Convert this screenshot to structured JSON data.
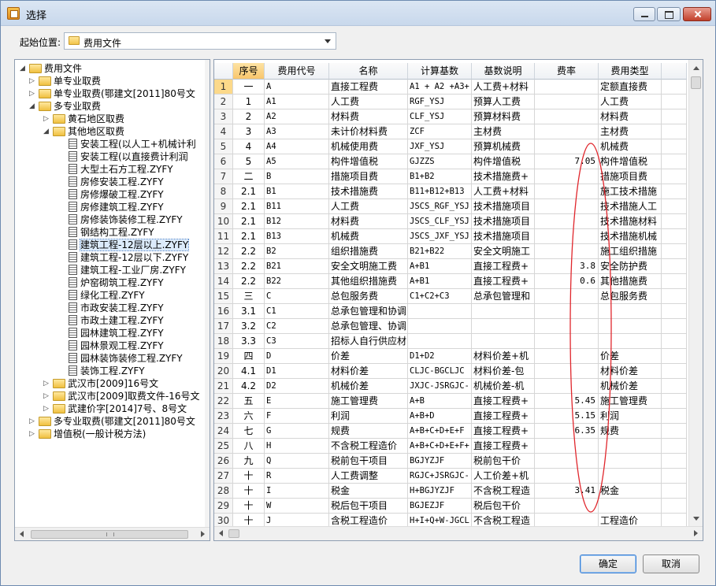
{
  "window": {
    "title": "选择"
  },
  "start": {
    "label": "起始位置:",
    "value": "费用文件"
  },
  "tree": [
    {
      "label": "费用文件",
      "level": 0,
      "type": "folder",
      "expander": "◢"
    },
    {
      "label": "单专业取费",
      "level": 1,
      "type": "folder",
      "expander": "▷"
    },
    {
      "label": "单专业取费(鄂建文[2011]80号文",
      "level": 1,
      "type": "folder",
      "expander": "▷"
    },
    {
      "label": "多专业取费",
      "level": 1,
      "type": "folder",
      "expander": "◢"
    },
    {
      "label": "黄石地区取费",
      "level": 2,
      "type": "folder",
      "expander": "▷"
    },
    {
      "label": "其他地区取费",
      "level": 2,
      "type": "folder",
      "expander": "◢"
    },
    {
      "label": "安装工程(以人工+机械计利",
      "level": 3,
      "type": "doc",
      "expander": ""
    },
    {
      "label": "安装工程(以直接费计利润",
      "level": 3,
      "type": "doc",
      "expander": ""
    },
    {
      "label": "大型土石方工程.ZYFY",
      "level": 3,
      "type": "doc",
      "expander": ""
    },
    {
      "label": "房修安装工程.ZYFY",
      "level": 3,
      "type": "doc",
      "expander": ""
    },
    {
      "label": "房修爆破工程.ZYFY",
      "level": 3,
      "type": "doc",
      "expander": ""
    },
    {
      "label": "房修建筑工程.ZYFY",
      "level": 3,
      "type": "doc",
      "expander": ""
    },
    {
      "label": "房修装饰装修工程.ZYFY",
      "level": 3,
      "type": "doc",
      "expander": ""
    },
    {
      "label": "钢结构工程.ZYFY",
      "level": 3,
      "type": "doc",
      "expander": ""
    },
    {
      "label": "建筑工程-12层以上.ZYFY",
      "level": 3,
      "type": "doc",
      "expander": "",
      "selected": true
    },
    {
      "label": "建筑工程-12层以下.ZYFY",
      "level": 3,
      "type": "doc",
      "expander": ""
    },
    {
      "label": "建筑工程-工业厂房.ZYFY",
      "level": 3,
      "type": "doc",
      "expander": ""
    },
    {
      "label": "炉窑砌筑工程.ZYFY",
      "level": 3,
      "type": "doc",
      "expander": ""
    },
    {
      "label": "绿化工程.ZYFY",
      "level": 3,
      "type": "doc",
      "expander": ""
    },
    {
      "label": "市政安装工程.ZYFY",
      "level": 3,
      "type": "doc",
      "expander": ""
    },
    {
      "label": "市政土建工程.ZYFY",
      "level": 3,
      "type": "doc",
      "expander": ""
    },
    {
      "label": "园林建筑工程.ZYFY",
      "level": 3,
      "type": "doc",
      "expander": ""
    },
    {
      "label": "园林景观工程.ZYFY",
      "level": 3,
      "type": "doc",
      "expander": ""
    },
    {
      "label": "园林装饰装修工程.ZYFY",
      "level": 3,
      "type": "doc",
      "expander": ""
    },
    {
      "label": "装饰工程.ZYFY",
      "level": 3,
      "type": "doc",
      "expander": ""
    },
    {
      "label": "武汉市[2009]16号文",
      "level": 2,
      "type": "folder",
      "expander": "▷"
    },
    {
      "label": "武汉市[2009]取费文件-16号文",
      "level": 2,
      "type": "folder",
      "expander": "▷"
    },
    {
      "label": "武建价字[2014]7号、8号文",
      "level": 2,
      "type": "folder",
      "expander": "▷"
    },
    {
      "label": "多专业取费(鄂建文[2011]80号文",
      "level": 1,
      "type": "folder",
      "expander": "▷"
    },
    {
      "label": "增值税(一般计税方法)",
      "level": 1,
      "type": "folder",
      "expander": "▷"
    }
  ],
  "grid": {
    "columns": [
      "",
      "序号",
      "费用代号",
      "名称",
      "计算基数",
      "基数说明",
      "费率",
      "费用类型"
    ],
    "rows": [
      [
        "1",
        "一",
        "A",
        "直接工程费",
        "A1 + A2 +A3+",
        "人工费+材料",
        "",
        "定额直接费"
      ],
      [
        "2",
        "1",
        "A1",
        "人工费",
        "RGF_YSJ",
        "预算人工费",
        "",
        "人工费"
      ],
      [
        "3",
        "2",
        "A2",
        "材料费",
        "CLF_YSJ",
        "预算材料费",
        "",
        "材料费"
      ],
      [
        "4",
        "3",
        "A3",
        "未计价材料费",
        "ZCF",
        "主材费",
        "",
        "主材费"
      ],
      [
        "5",
        "4",
        "A4",
        "机械使用费",
        "JXF_YSJ",
        "预算机械费",
        "",
        "机械费"
      ],
      [
        "6",
        "5",
        "A5",
        "构件增值税",
        "GJZZS",
        "构件增值税",
        "7.05",
        "构件增值税"
      ],
      [
        "7",
        "二",
        "B",
        "措施项目费",
        "B1+B2",
        "技术措施费+",
        "",
        "措施项目费"
      ],
      [
        "8",
        "2.1",
        "B1",
        "技术措施费",
        "B11+B12+B13",
        "人工费+材料",
        "",
        "施工技术措施"
      ],
      [
        "9",
        "2.1",
        "B11",
        "人工费",
        "JSCS_RGF_YSJ",
        "技术措施项目",
        "",
        "技术措施人工"
      ],
      [
        "10",
        "2.1",
        "B12",
        "材料费",
        "JSCS_CLF_YSJ",
        "技术措施项目",
        "",
        "技术措施材料"
      ],
      [
        "11",
        "2.1",
        "B13",
        "机械费",
        "JSCS_JXF_YSJ",
        "技术措施项目",
        "",
        "技术措施机械"
      ],
      [
        "12",
        "2.2",
        "B2",
        "组织措施费",
        "B21+B22",
        "安全文明施工",
        "",
        "施工组织措施"
      ],
      [
        "13",
        "2.2",
        "B21",
        "安全文明施工费",
        "A+B1",
        "直接工程费+",
        "3.8",
        "安全防护费"
      ],
      [
        "14",
        "2.2",
        "B22",
        "其他组织措施费",
        "A+B1",
        "直接工程费+",
        "0.6",
        "其他措施费"
      ],
      [
        "15",
        "三",
        "C",
        "总包服务费",
        "C1+C2+C3",
        "总承包管理和",
        "",
        "总包服务费"
      ],
      [
        "16",
        "3.1",
        "C1",
        "总承包管理和协调",
        "",
        "",
        "",
        ""
      ],
      [
        "17",
        "3.2",
        "C2",
        "总承包管理、协调",
        "",
        "",
        "",
        ""
      ],
      [
        "18",
        "3.3",
        "C3",
        "招标人自行供应材",
        "",
        "",
        "",
        ""
      ],
      [
        "19",
        "四",
        "D",
        "价差",
        "D1+D2",
        "材料价差+机",
        "",
        "价差"
      ],
      [
        "20",
        "4.1",
        "D1",
        "材料价差",
        "CLJC-BGCLJC",
        "材料价差-包",
        "",
        "材料价差"
      ],
      [
        "21",
        "4.2",
        "D2",
        "机械价差",
        "JXJC-JSRGJC-",
        "机械价差-机",
        "",
        "机械价差"
      ],
      [
        "22",
        "五",
        "E",
        "施工管理费",
        "A+B",
        "直接工程费+",
        "5.45",
        "施工管理费"
      ],
      [
        "23",
        "六",
        "F",
        "利润",
        "A+B+D",
        "直接工程费+",
        "5.15",
        "利润"
      ],
      [
        "24",
        "七",
        "G",
        "规费",
        "A+B+C+D+E+F",
        "直接工程费+",
        "6.35",
        "规费"
      ],
      [
        "25",
        "八",
        "H",
        "不含税工程造价",
        "A+B+C+D+E+F+",
        "直接工程费+",
        "",
        ""
      ],
      [
        "26",
        "九",
        "Q",
        "税前包干项目",
        "BGJYZJF",
        "税前包干价",
        "",
        ""
      ],
      [
        "27",
        "十",
        "R",
        "人工费调整",
        "RGJC+JSRGJC-",
        "人工价差+机",
        "",
        ""
      ],
      [
        "28",
        "十",
        "I",
        "税金",
        "H+BGJYZJF",
        "不含税工程造",
        "3.41",
        "税金"
      ],
      [
        "29",
        "十",
        "W",
        "税后包干项目",
        "BGJEZJF",
        "税后包干价",
        "",
        ""
      ],
      [
        "30",
        "十",
        "J",
        "含税工程造价",
        "H+I+Q+W-JGCL",
        "不含税工程造",
        "",
        "工程造价"
      ]
    ]
  },
  "buttons": {
    "ok": "确定",
    "cancel": "取消"
  },
  "colors": {
    "annotation": "#e0262c",
    "header_selected": "#f9c66c",
    "tree_selected": "#dcebfb"
  }
}
